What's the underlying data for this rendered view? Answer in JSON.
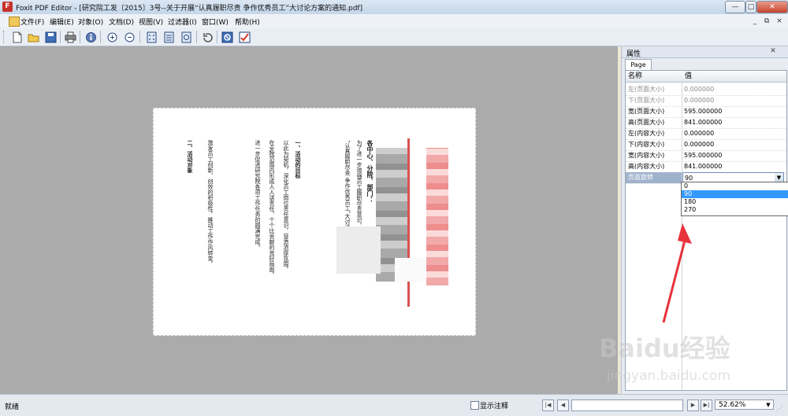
{
  "window": {
    "app_icon": "foxit-logo-icon",
    "title": "Foxit PDF Editor - [研究院工发〔2015〕3号--关于开展“认真履职尽责 争作优秀员工”大讨论方案的通知.pdf]",
    "minimize_label": "—",
    "maximize_label": "□",
    "close_label": "✕",
    "mdi_minimize": "_",
    "mdi_restore": "⧉",
    "mdi_close": "×"
  },
  "menu": {
    "items": [
      "文件(F)",
      "编辑(E)",
      "对象(O)",
      "文档(D)",
      "视图(V)",
      "过滤器(I)",
      "窗口(W)",
      "帮助(H)"
    ]
  },
  "toolbar": {
    "icons": [
      "edit-icon",
      "new-document-icon",
      "open-folder-icon",
      "save-icon",
      "print-icon",
      "info-icon",
      "zoom-in-icon",
      "zoom-out-icon",
      "fit-page-icon",
      "fit-width-icon",
      "actual-size-icon",
      "rotate-icon",
      "stop-icon",
      "checkmark-icon"
    ]
  },
  "document": {
    "columns": [
      "各中心、分院、部门：",
      "为了进一步增强员工履职尽责意识，研究院决定开展",
      "“认真履职尽责 争作优秀员工”大讨论活动，方案如下：",
      "一、活动的目标",
      "以此为契机，深化员工岗位责任意识，营造浓厚氛围，",
      "在全院范围内形成人人讲责任、个个比贡献的良好局面，",
      "进一步促进研究院各项工作任务的圆满完成。",
      "激发员工创新、创效的积极性，推动工作作风转变，",
      "二、活动对象"
    ]
  },
  "panel": {
    "title": "属性",
    "close_label": "✕",
    "tab": "Page",
    "header_name": "名称",
    "header_value": "值",
    "rows": [
      {
        "name": "左(页面大小)",
        "value": "0.000000"
      },
      {
        "name": "下(页面大小)",
        "value": "0.000000"
      },
      {
        "name": "宽(页面大小)",
        "value": "595.000000"
      },
      {
        "name": "高(页面大小)",
        "value": "841.000000"
      },
      {
        "name": "左(内容大小)",
        "value": "0.000000"
      },
      {
        "name": "下(内容大小)",
        "value": "0.000000"
      },
      {
        "name": "宽(内容大小)",
        "value": "595.000000"
      },
      {
        "name": "高(内容大小)",
        "value": "841.000000"
      }
    ],
    "selected_row": {
      "name": "页面旋转",
      "value": "90"
    },
    "dropdown_options": [
      "0",
      "90",
      "180",
      "270"
    ],
    "dropdown_selected": "90"
  },
  "statusbar": {
    "status": "就绪",
    "show_annotations_label": "显示注释",
    "zoom": "52.62%",
    "nav_icons": [
      "first-page-icon",
      "previous-page-icon",
      "next-page-icon",
      "last-page-icon"
    ]
  },
  "colors": {
    "arrow": "#e8323c",
    "selection": "#3399ff",
    "workspace": "#ababab"
  },
  "watermark": {
    "brand": "Baidu经验",
    "url": "jingyan.baidu.com"
  }
}
